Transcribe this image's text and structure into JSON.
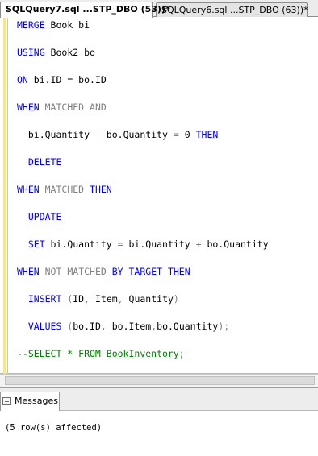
{
  "tabs": [
    {
      "label": "SQLQuery7.sql ...STP_DBO (53))*",
      "active": true
    },
    {
      "label": "SQLQuery6.sql ...STP_DBO (63))*",
      "active": false
    }
  ],
  "code": {
    "line1": {
      "kw1": "MERGE",
      "rest": " Book bi"
    },
    "line2": {
      "kw1": "USING",
      "rest": " Book2 bo"
    },
    "line3": {
      "kw1": "ON",
      "rest": " bi.ID = bo.ID"
    },
    "line4": {
      "kw1": "WHEN",
      "g1": " MATCHED AND"
    },
    "line5": {
      "lead": "  bi.Quantity ",
      "op1": "+",
      "mid": " bo.Quantity ",
      "op2": "=",
      "num": " 0 ",
      "kw1": "THEN"
    },
    "line6": {
      "kw1": "  DELETE"
    },
    "line7": {
      "kw1": "WHEN",
      "g1": " MATCHED ",
      "kw2": "THEN"
    },
    "line8": {
      "kw1": "  UPDATE"
    },
    "line9": {
      "kw1": "  SET",
      "a": " bi.Quantity ",
      "op1": "=",
      "b": " bi.Quantity ",
      "op2": "+",
      "c": " bo.Quantity"
    },
    "line10": {
      "kw1": "WHEN",
      "g1": " NOT MATCHED ",
      "kw2": "BY TARGET THEN"
    },
    "line11": {
      "kw1": "  INSERT",
      "g1": " (",
      "a": "ID",
      "g2": ",",
      "b": " Item",
      "g3": ",",
      "c": " Quantity",
      "g4": ")"
    },
    "line12": {
      "kw1": "  VALUES",
      "g1": " (",
      "a": "bo.ID",
      "g2": ",",
      "b": " bo.Item",
      "g3": ",",
      "c": "bo.Quantity",
      "g4": ");"
    },
    "line13": {
      "comment": "--SELECT * FROM BookInventory;"
    }
  },
  "results": {
    "tab_label": "Messages",
    "message": "(5 row(s) affected)"
  },
  "colors": {
    "keyword": "#0000ff",
    "gray_keyword": "#808080",
    "comment": "#008000"
  },
  "icons": {
    "messages_tab": "messages-icon"
  }
}
